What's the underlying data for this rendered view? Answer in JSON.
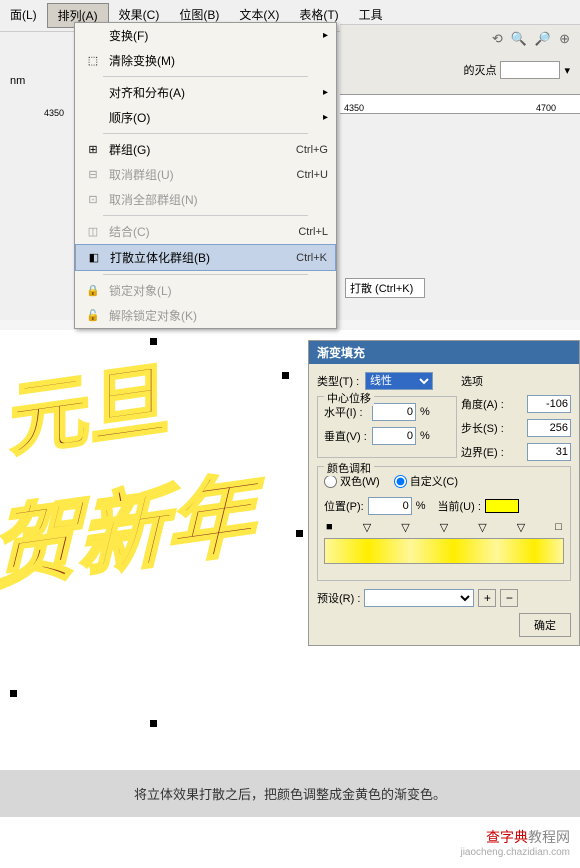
{
  "menubar": {
    "items": [
      {
        "label": "面(L)"
      },
      {
        "label": "排列(A)",
        "active": true
      },
      {
        "label": "效果(C)"
      },
      {
        "label": "位图(B)"
      },
      {
        "label": "文本(X)"
      },
      {
        "label": "表格(T)"
      },
      {
        "label": "工具"
      }
    ]
  },
  "dropdown": {
    "items": [
      {
        "label": "变换(F)",
        "arrow": true
      },
      {
        "label": "清除变换(M)",
        "icon": "⬚"
      },
      {
        "sep": true
      },
      {
        "label": "对齐和分布(A)",
        "arrow": true
      },
      {
        "label": "顺序(O)",
        "arrow": true
      },
      {
        "sep": true
      },
      {
        "label": "群组(G)",
        "shortcut": "Ctrl+G",
        "icon": "⊞"
      },
      {
        "label": "取消群组(U)",
        "shortcut": "Ctrl+U",
        "disabled": true,
        "icon": "⊟"
      },
      {
        "label": "取消全部群组(N)",
        "disabled": true,
        "icon": "⊡"
      },
      {
        "sep": true
      },
      {
        "label": "结合(C)",
        "shortcut": "Ctrl+L",
        "disabled": true,
        "icon": "◫"
      },
      {
        "label": "打散立体化群组(B)",
        "shortcut": "Ctrl+K",
        "highlighted": true,
        "icon": "◧"
      },
      {
        "sep": true
      },
      {
        "label": "锁定对象(L)",
        "disabled": true,
        "icon": "🔒"
      },
      {
        "label": "解除锁定对象(K)",
        "disabled": true,
        "icon": "🔓"
      }
    ]
  },
  "toolbar_right": {
    "field_label": "的灭点",
    "icons": [
      "⟲",
      "🔍",
      "🔎",
      "⊕"
    ]
  },
  "ruler": {
    "tick_left": "4350",
    "tick_right": "4700"
  },
  "units": "nm",
  "extrude_button": "打散 (Ctrl+K)",
  "dialog": {
    "title": "渐变填充",
    "type_label": "类型(T) :",
    "type_value": "线性",
    "options_label": "选项",
    "angle_label": "角度(A) :",
    "angle_value": "-106",
    "center_offset_label": "中心位移",
    "horiz_label": "水平(I) :",
    "horiz_value": "0",
    "vert_label": "垂直(V) :",
    "vert_value": "0",
    "step_label": "步长(S) :",
    "step_value": "256",
    "edge_label": "边界(E) :",
    "edge_value": "31",
    "percent": "%",
    "color_blend_label": "颜色调和",
    "twocolor_label": "双色(W)",
    "custom_label": "自定义(C)",
    "position_label": "位置(P):",
    "position_value": "0",
    "current_label": "当前(U) :",
    "preset_label": "预设(R) :",
    "ok_label": "确定",
    "plus": "+",
    "minus": "−"
  },
  "caption": "将立体效果打散之后，把颜色调整成金黄色的渐变色。",
  "footer": {
    "brand_a": "查字典",
    "brand_b": "教程网",
    "sub": "jiaocheng.chazidian.com"
  }
}
